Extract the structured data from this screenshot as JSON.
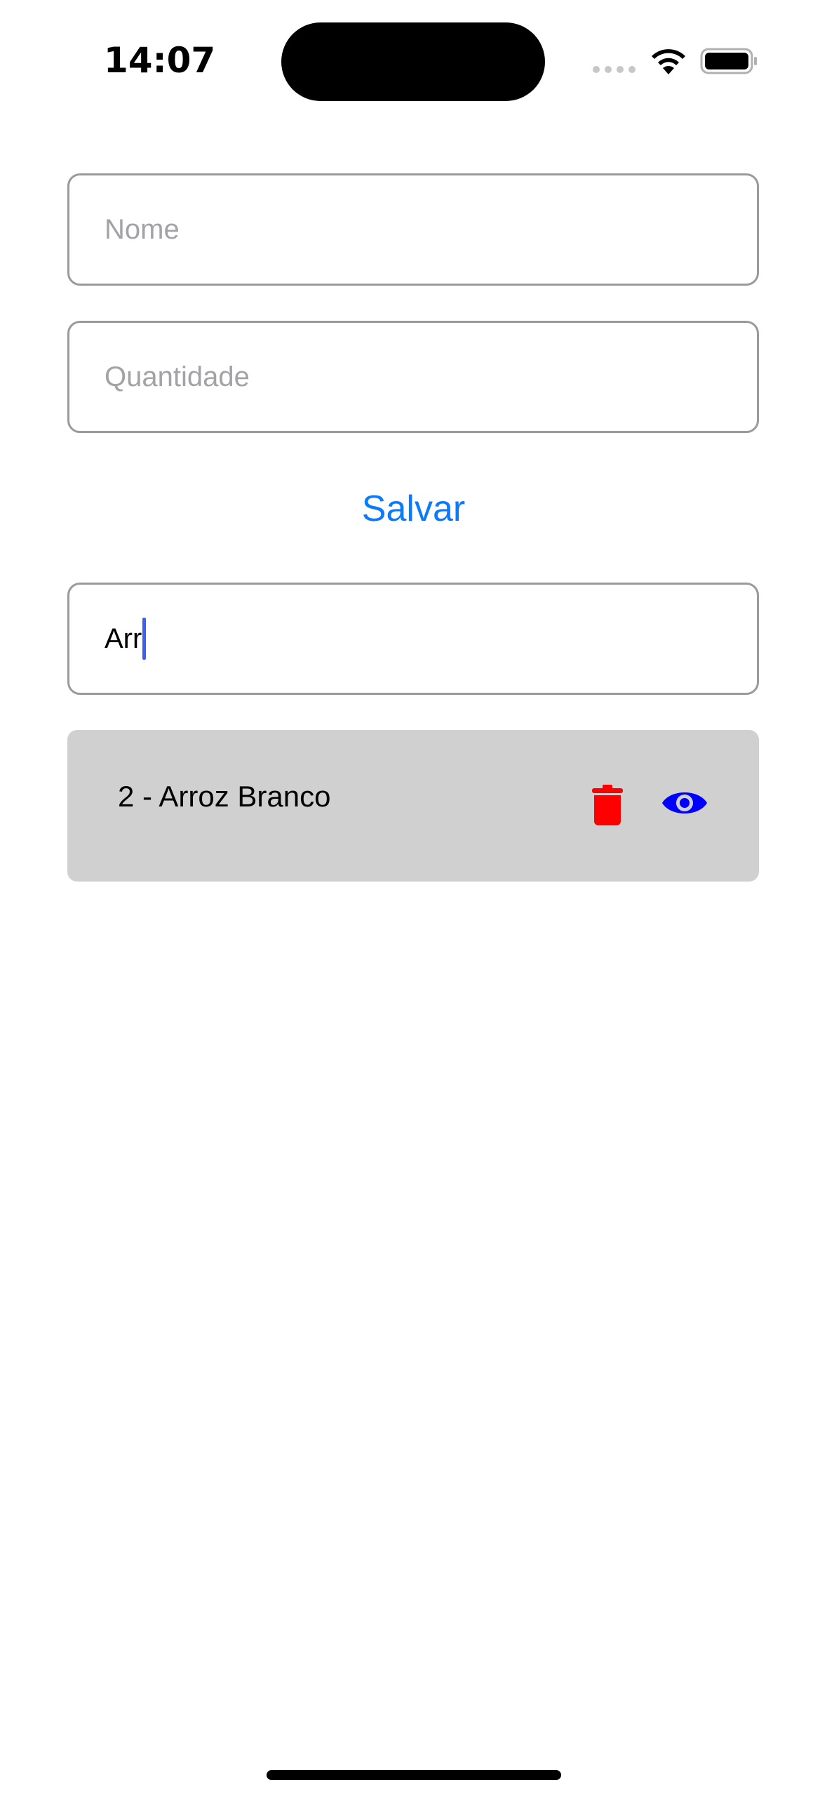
{
  "status_bar": {
    "time": "14:07",
    "wifi_icon": "wifi-icon",
    "battery_icon": "battery-icon"
  },
  "form": {
    "nome": {
      "placeholder": "Nome",
      "value": ""
    },
    "quantidade": {
      "placeholder": "Quantidade",
      "value": ""
    },
    "save_label": "Salvar"
  },
  "search": {
    "value": "Arr"
  },
  "list": {
    "items": [
      {
        "label": "2 - Arroz Branco",
        "delete_icon": "trash-icon",
        "view_icon": "eye-icon"
      }
    ]
  },
  "colors": {
    "accent": "#0a7aff",
    "delete": "#ff0000",
    "view": "#0000ff",
    "list_item_background": "#d0d0d0",
    "caret": "#3e5df2"
  }
}
